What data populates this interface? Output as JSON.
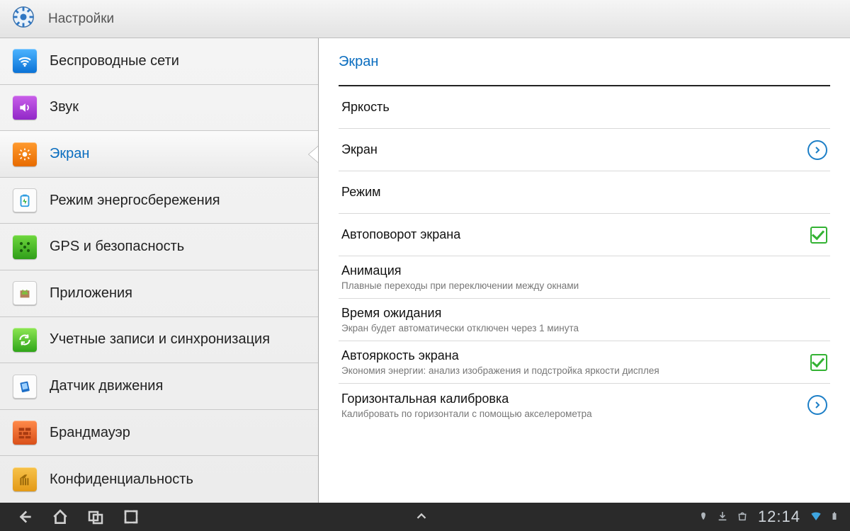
{
  "header": {
    "title": "Настройки"
  },
  "sidebar": {
    "items": [
      {
        "id": "wireless",
        "label": "Беспроводные сети",
        "selected": false
      },
      {
        "id": "sound",
        "label": "Звук",
        "selected": false
      },
      {
        "id": "display",
        "label": "Экран",
        "selected": true
      },
      {
        "id": "power",
        "label": "Режим энергосбережения",
        "selected": false
      },
      {
        "id": "gps",
        "label": "GPS и безопасность",
        "selected": false
      },
      {
        "id": "apps",
        "label": "Приложения",
        "selected": false
      },
      {
        "id": "accounts",
        "label": "Учетные записи и синхронизация",
        "selected": false
      },
      {
        "id": "motion",
        "label": "Датчик движения",
        "selected": false
      },
      {
        "id": "firewall",
        "label": "Брандмауэр",
        "selected": false
      },
      {
        "id": "privacy",
        "label": "Конфиденциальность",
        "selected": false
      }
    ]
  },
  "detail": {
    "title": "Экран",
    "rows": [
      {
        "id": "brightness",
        "title": "Яркость",
        "sub": "",
        "control": "none"
      },
      {
        "id": "screen",
        "title": "Экран",
        "sub": "",
        "control": "chevron"
      },
      {
        "id": "mode",
        "title": "Режим",
        "sub": "",
        "control": "none"
      },
      {
        "id": "autorotate",
        "title": "Автоповорот экрана",
        "sub": "",
        "control": "check",
        "checked": true
      },
      {
        "id": "animation",
        "title": "Анимация",
        "sub": "Плавные переходы при переключении между окнами",
        "control": "none"
      },
      {
        "id": "timeout",
        "title": "Время ожидания",
        "sub": "Экран будет автоматически отключен через 1 минута",
        "control": "none"
      },
      {
        "id": "autobright",
        "title": "Автояркость экрана",
        "sub": "Экономия энергии: анализ изображения и подстройка яркости дисплея",
        "control": "check",
        "checked": true
      },
      {
        "id": "hcalib",
        "title": "Горизонтальная калибровка",
        "sub": "Калибровать по горизонтали с помощью акселерометра",
        "control": "chevron"
      }
    ]
  },
  "statusbar": {
    "time": "12:14"
  }
}
